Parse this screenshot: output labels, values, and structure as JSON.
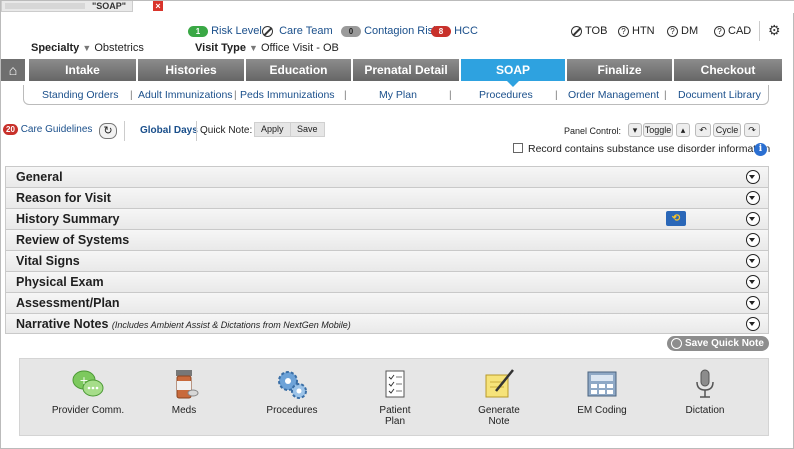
{
  "window": {
    "tab_title": "\"SOAP\"",
    "close_glyph": "×"
  },
  "header": {
    "risk_level": {
      "label": "Risk Level",
      "pill": "1"
    },
    "care_team": "Care Team",
    "contagion_risk": {
      "label": "Contagion Risk",
      "pill": "0"
    },
    "hcc": {
      "label": "HCC",
      "pill": "8"
    },
    "flags": [
      "TOB",
      "HTN",
      "DM",
      "CAD"
    ],
    "specialty_label": "Specialty",
    "specialty_value": "Obstetrics",
    "visit_type_label": "Visit Type",
    "visit_type_value": "Office Visit - OB"
  },
  "nav": {
    "tabs": [
      "Intake",
      "Histories",
      "Education",
      "Prenatal Detail",
      "SOAP",
      "Finalize",
      "Checkout"
    ],
    "active": "SOAP"
  },
  "subnav": [
    "Standing Orders",
    "Adult Immunizations",
    "Peds Immunizations",
    "My Plan",
    "Procedures",
    "Order Management",
    "Document Library"
  ],
  "toolbar": {
    "care_guidelines_badge": "20",
    "care_guidelines": "Care Guidelines",
    "global_days": "Global Days",
    "quick_note": "Quick Note:",
    "apply": "Apply",
    "save": "Save",
    "panel_control": "Panel Control:",
    "toggle": "Toggle",
    "cycle": "Cycle",
    "substance_checkbox_label": "Record contains substance use disorder information"
  },
  "panels": [
    {
      "title": "General"
    },
    {
      "title": "Reason for Visit"
    },
    {
      "title": "History Summary"
    },
    {
      "title": "Review of Systems"
    },
    {
      "title": "Vital Signs"
    },
    {
      "title": "Physical Exam"
    },
    {
      "title": "Assessment/Plan"
    },
    {
      "title": "Narrative Notes",
      "subtitle": "(Includes Ambient Assist & Dictations from NextGen Mobile)"
    }
  ],
  "save_quick_note": "Save Quick Note",
  "actions": [
    {
      "label": "Provider Comm.",
      "icon": "chat-bubbles-icon"
    },
    {
      "label": "Meds",
      "icon": "pill-bottle-icon"
    },
    {
      "label": "Procedures",
      "icon": "gears-icon"
    },
    {
      "label": "Patient Plan",
      "icon": "checklist-icon"
    },
    {
      "label": "Generate Note",
      "icon": "note-pen-icon"
    },
    {
      "label": "EM Coding",
      "icon": "calculator-icon"
    },
    {
      "label": "Dictation",
      "icon": "microphone-icon"
    }
  ],
  "colors": {
    "accent": "#2ea2e0",
    "nav_gray": "#777777",
    "link": "#1a4f8b",
    "alert_red": "#c8312b",
    "risk_green": "#3aa845"
  }
}
